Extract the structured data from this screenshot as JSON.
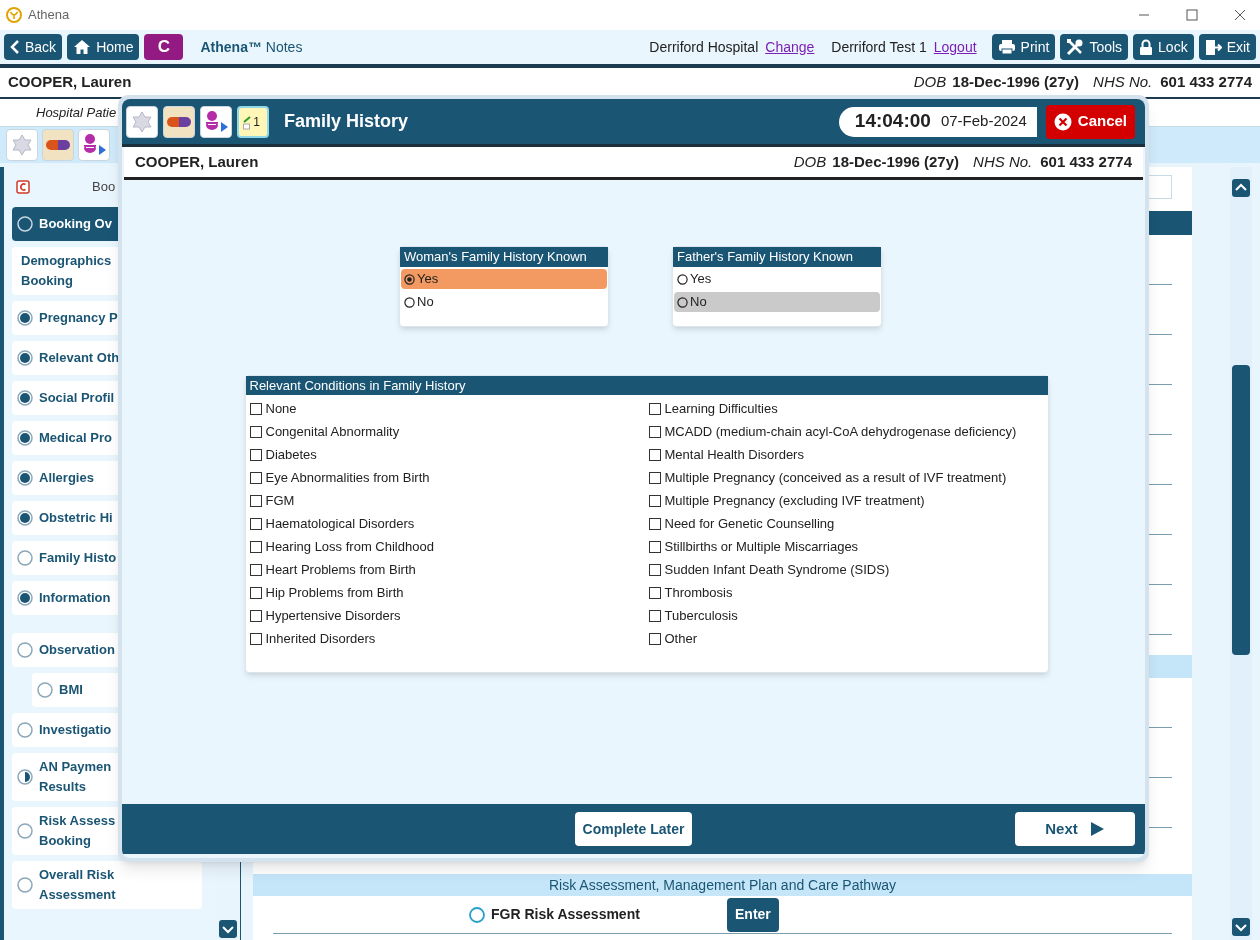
{
  "window": {
    "title": "Athena"
  },
  "nav": {
    "buttons": [
      {
        "kind": "back",
        "label": "Back"
      },
      {
        "kind": "home",
        "label": "Home"
      },
      {
        "kind": "letter",
        "label": "C"
      }
    ],
    "app_name": "**Athena™** Notes",
    "location": "Derriford Hospital",
    "location_link": "Change",
    "user": "Derriford Test 1",
    "user_link": "Logout",
    "actions": [
      {
        "kind": "print",
        "label": "Print"
      },
      {
        "kind": "tools",
        "label": "Tools"
      },
      {
        "kind": "lock",
        "label": "Lock"
      },
      {
        "kind": "exit",
        "label": "Exit"
      }
    ]
  },
  "patient": {
    "name": "COOPER, Lauren",
    "dob_label": "DOB",
    "dob": "18-Dec-1996 (27y)",
    "nhs_label": "NHS No.",
    "nhs": "601 433 2774"
  },
  "subheader": "Hospital Patie",
  "toolbar": [
    {
      "kind": "flower"
    },
    {
      "kind": "pill"
    },
    {
      "kind": "person"
    }
  ],
  "sidebar": {
    "heading": "Boo",
    "items": [
      {
        "label": "Booking Ov",
        "kind": "empty",
        "selected": true
      },
      {
        "label": "Demographics\nBooking",
        "kind": "plain",
        "selected": false
      },
      {
        "label": "Pregnancy P",
        "kind": "complete",
        "selected": false
      },
      {
        "label": "Relevant Oth",
        "kind": "complete",
        "selected": false
      },
      {
        "label": "Social Profil",
        "kind": "complete",
        "selected": false
      },
      {
        "label": "Medical Pro",
        "kind": "complete",
        "selected": false
      },
      {
        "label": "Allergies",
        "kind": "complete",
        "selected": false
      },
      {
        "label": "Obstetric Hi",
        "kind": "complete",
        "selected": false
      },
      {
        "label": "Family Histo",
        "kind": "empty",
        "selected": false
      },
      {
        "label": "Information",
        "kind": "complete",
        "selected": false
      },
      {
        "label": "Observation",
        "kind": "empty",
        "selected": false,
        "children": [
          {
            "label": "BMI",
            "kind": "empty",
            "selected": false
          }
        ]
      },
      {
        "label": "Investigatio",
        "kind": "empty",
        "selected": false
      },
      {
        "label": "AN Paymen\nResults",
        "kind": "partial",
        "selected": false
      },
      {
        "label": "Risk Assess\nBooking",
        "kind": "empty",
        "selected": false
      },
      {
        "label": "Overall Risk\nAssessment",
        "kind": "empty",
        "selected": false
      }
    ]
  },
  "content": {
    "section": "Risk Assessment, Management Plan and Care Pathway",
    "rows": [
      {
        "label": "FGR Risk Assessment",
        "button": "Enter"
      }
    ]
  },
  "dialog": {
    "title": "Family History",
    "tools": [
      {
        "kind": "flower",
        "selected": false
      },
      {
        "kind": "pill",
        "selected": false
      },
      {
        "kind": "person",
        "selected": false
      },
      {
        "kind": "notepad",
        "label": "1",
        "selected": true
      }
    ],
    "time": "14:04:00",
    "date": "07-Feb-2024",
    "cancel": "Cancel",
    "patient": {
      "name": "COOPER, Lauren",
      "dob_label": "DOB",
      "dob": "18-Dec-1996 (27y)",
      "nhs_label": "NHS No.",
      "nhs": "601 433 2774"
    },
    "groups": [
      {
        "title": "Woman's Family History Known",
        "options": [
          {
            "label": "Yes",
            "selected": true,
            "hovered": false
          },
          {
            "label": "No",
            "selected": false,
            "hovered": false
          }
        ]
      },
      {
        "title": "Father's Family History Known",
        "options": [
          {
            "label": "Yes",
            "selected": false,
            "hovered": false
          },
          {
            "label": "No",
            "selected": false,
            "hovered": true
          }
        ]
      }
    ],
    "conditions": {
      "title": "Relevant Conditions in Family History",
      "items": [
        {
          "label": "None",
          "checked": false
        },
        {
          "label": "Congenital Abnormality",
          "checked": false
        },
        {
          "label": "Diabetes",
          "checked": false
        },
        {
          "label": "Eye Abnormalities from Birth",
          "checked": false
        },
        {
          "label": "FGM",
          "checked": false
        },
        {
          "label": "Haematological Disorders",
          "checked": false
        },
        {
          "label": "Hearing Loss from Childhood",
          "checked": false
        },
        {
          "label": "Heart Problems from Birth",
          "checked": false
        },
        {
          "label": "Hip Problems from Birth",
          "checked": false
        },
        {
          "label": "Hypertensive Disorders",
          "checked": false
        },
        {
          "label": "Inherited Disorders",
          "checked": false
        },
        {
          "label": "Learning Difficulties",
          "checked": false
        },
        {
          "label": "MCADD (medium-chain acyl-CoA dehydrogenase deficiency)",
          "checked": false
        },
        {
          "label": "Mental Health Disorders",
          "checked": false
        },
        {
          "label": "Multiple Pregnancy (conceived as a result of IVF treatment)",
          "checked": false
        },
        {
          "label": "Multiple Pregnancy (excluding IVF treatment)",
          "checked": false
        },
        {
          "label": "Need for Genetic Counselling",
          "checked": false
        },
        {
          "label": "Stillbirths or Multiple Miscarriages",
          "checked": false
        },
        {
          "label": "Sudden Infant Death Syndrome (SIDS)",
          "checked": false
        },
        {
          "label": "Thrombosis",
          "checked": false
        },
        {
          "label": "Tuberculosis",
          "checked": false
        },
        {
          "label": "Other",
          "checked": false
        }
      ]
    },
    "buttons": [
      {
        "kind": "later",
        "label": "Complete Later"
      },
      {
        "kind": "next",
        "label": "Next"
      }
    ]
  }
}
